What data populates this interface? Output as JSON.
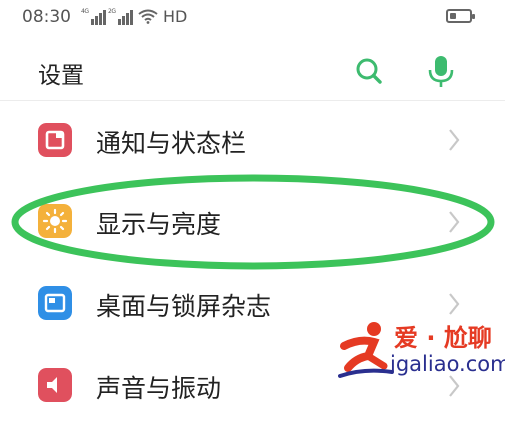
{
  "status_bar": {
    "time": "08:30",
    "signal_tag_1": "4G",
    "signal_tag_2": "2G",
    "network": "HD",
    "icons": [
      "signal-icon",
      "signal-icon",
      "wifi-icon",
      "battery-icon"
    ],
    "battery_level": 0.35
  },
  "header": {
    "title": "设置",
    "search_icon": "search-icon",
    "mic_icon": "microphone-icon",
    "accent_color": "#3dbb6f"
  },
  "settings_items": [
    {
      "label": "通知与状态栏",
      "icon": "notification-icon",
      "icon_color": "#e0505e"
    },
    {
      "label": "显示与亮度",
      "icon": "brightness-icon",
      "icon_color": "#f4b13b"
    },
    {
      "label": "桌面与锁屏杂志",
      "icon": "wallpaper-icon",
      "icon_color": "#2f8fe6"
    },
    {
      "label": "声音与振动",
      "icon": "sound-icon",
      "icon_color": "#e0505e"
    }
  ],
  "highlight_color": "#3cc35a",
  "watermark": {
    "cn": "爱 · 尬聊",
    "en": "igaliao.com",
    "brand_red": "#e53a23",
    "brand_blue": "#2a2f8f"
  }
}
